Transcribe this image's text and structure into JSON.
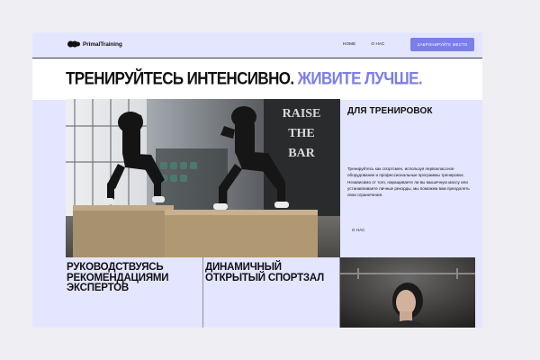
{
  "brand": {
    "name": "PrimalTraining"
  },
  "nav": {
    "items": [
      "HOME",
      "О НАС"
    ]
  },
  "header": {
    "cta_label": "ЗАБРОНИРУЙТЕ МЕСТО"
  },
  "hero": {
    "title_main": "ТРЕНИРУЙТЕСЬ ИНТЕНСИВНО.",
    "title_accent": "ЖИВИТЕ ЛУЧШЕ."
  },
  "gym_photo": {
    "sign_lines": [
      "RAISE",
      "THE",
      "BAR"
    ]
  },
  "side": {
    "title": "ДЛЯ ТРЕНИРОВОК",
    "text": "Тренируйтесь как спортсмен, используя первоклассное оборудование и профессиональные программы тренировок. Независимо от того, наращиваете ли вы мышечную массу или устанавливаете личные рекорды, мы поможем вам преодолеть свои ограничения.",
    "link_label": "О НАС"
  },
  "cards": [
    {
      "title": "РУКОВОДСТВУЯСЬ РЕКОМЕНДАЦИЯМИ ЭКСПЕРТОВ"
    },
    {
      "title": "ДИНАМИЧНЫЙ ОТКРЫТЫЙ СПОРТЗАЛ"
    }
  ],
  "colors": {
    "accent": "#7b7eea",
    "panel": "#e4e5ff",
    "page_bg": "#efeff3",
    "text": "#111111"
  }
}
